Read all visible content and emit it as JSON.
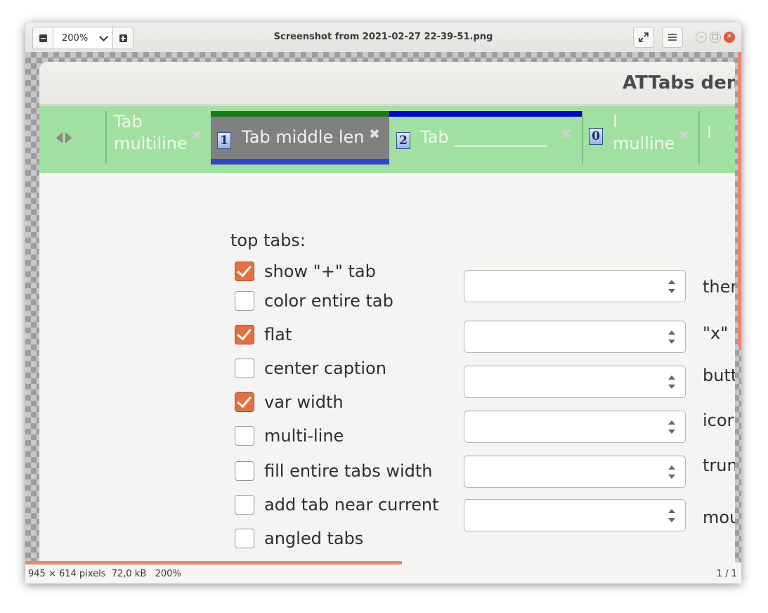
{
  "window": {
    "title": "Screenshot from 2021-02-27 22-39-51.png",
    "zoom": "200%"
  },
  "image": {
    "app_title": "ATTabs den",
    "tabs": [
      {
        "line1": "Tab",
        "line2": "multiline"
      },
      {
        "label": "Tab middle len",
        "badge": "1"
      },
      {
        "label": "Tab ___________",
        "badge": "2"
      },
      {
        "line1": "I",
        "line2": "mulline",
        "badge": "0"
      },
      {
        "label": "I"
      }
    ],
    "section_label": "top tabs:",
    "options": [
      {
        "label": "show \"+\" tab",
        "checked": true
      },
      {
        "label": "color entire tab",
        "checked": false
      },
      {
        "label": "flat",
        "checked": true
      },
      {
        "label": "center caption",
        "checked": false
      },
      {
        "label": "var width",
        "checked": true
      },
      {
        "label": "multi-line",
        "checked": false
      },
      {
        "label": "fill entire tabs width",
        "checked": false
      },
      {
        "label": "add tab near current",
        "checked": false
      },
      {
        "label": "angled tabs",
        "checked": false
      }
    ],
    "right_labels": [
      "ther",
      "\"x\" i",
      "butt",
      "icor",
      "trun",
      "mou"
    ]
  },
  "status": {
    "info": "945 × 614 pixels  72,0 kB   200%",
    "page": "1 / 1"
  },
  "colors": {
    "tabbar_bg": "#a0e0a0",
    "active_tab_bg": "#808080",
    "accent": "#e66f40"
  }
}
